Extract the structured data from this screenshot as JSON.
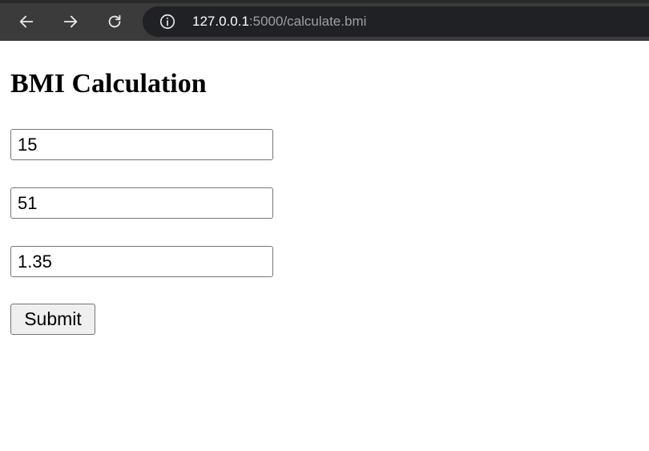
{
  "browser": {
    "url_host": "127.0.0.1",
    "url_path": ":5000/calculate.bmi",
    "icons": {
      "back": "arrow-left-icon",
      "forward": "arrow-right-icon",
      "reload": "reload-icon",
      "info": "info-icon"
    }
  },
  "page": {
    "title": "BMI Calculation",
    "fields": [
      {
        "value": "15"
      },
      {
        "value": "51"
      },
      {
        "value": "1.35"
      }
    ],
    "submit_label": "Submit"
  },
  "colors": {
    "toolbar_bg": "#3b3b3b",
    "omnibox_bg": "#202124",
    "url_host": "#ffffff",
    "url_path": "#9aa0a6"
  }
}
